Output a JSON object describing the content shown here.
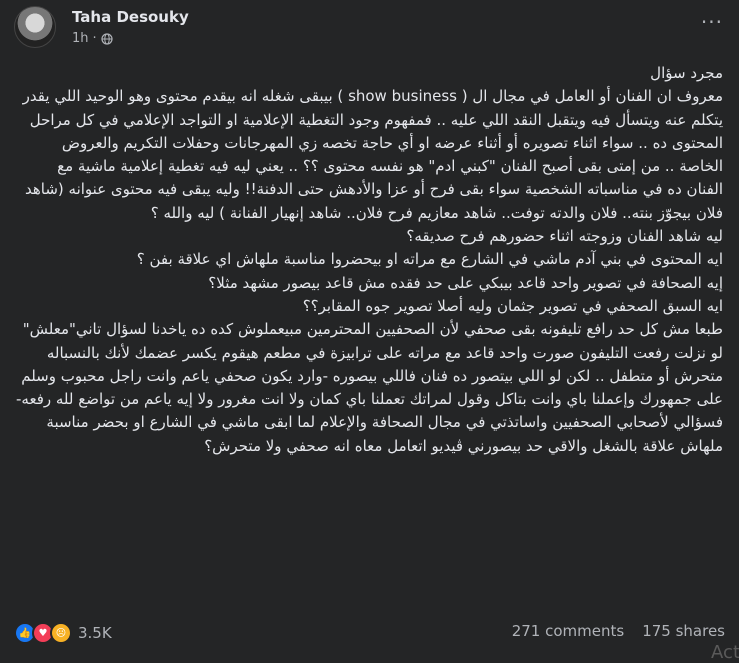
{
  "post": {
    "author": "Taha Desouky",
    "time": "1h",
    "separator": "·",
    "more": "···",
    "paragraphs": [
      "مجرد سؤال\nمعروف ان الفنان أو العامل في مجال ال ( show business ) بيبقى شغله انه بيقدم محتوى وهو الوحيد اللي يقدر يتكلم عنه ويتسأل فيه ويتقبل النقد اللي عليه .. فمفهوم وجود التغطية الإعلامية او التواجد الإعلامي في كل مراحل المحتوى ده .. سواء اثناء تصويره أو أثناء عرضه او أي حاجة تخصه زي المهرجانات وحفلات التكريم والعروض الخاصة .. من إمتى بقى أصبح الفنان \"كبني ادم\" هو نفسه محتوى ؟؟ .. يعني ليه فيه تغطية إعلامية ماشية مع الفنان ده في مناسباته الشخصية سواء بقى فرح أو عزا والأدهش حتى الدفنة!! وليه يبقى فيه محتوى عنوانه (شاهد فلان بيجوّز بنته.. فلان والدته توفت.. شاهد معازيم فرح فلان.. شاهد إنهيار الفنانة ) ليه والله ؟",
      "ليه شاهد الفنان وزوجته اثناء حضورهم فرح صديقه؟\nايه المحتوى في بني آدم ماشي في الشارع مع مراته او بيحضروا مناسبة ملهاش اي علاقة بفن ؟\nإيه الصحافة في تصوير واحد قاعد بيبكي على حد فقده مش قاعد بيصور مشهد مثلا؟\nايه السبق الصحفي في تصوير جثمان وليه أصلا تصوير جوه المقابر؟؟",
      "طبعا مش كل حد رافع تليفونه بقى صحفي لأن الصحفيين المحترمين مبيعملوش كده ده ياخدنا لسؤال تاني\"معلش\"",
      "لو نزلت رفعت التليفون صورت واحد قاعد مع مراته على ترابيزة في مطعم هيقوم يكسر عضمك لأنك بالنسباله متحرش أو متطفل .. لكن لو اللي بيتصور ده فنان فاللي بيصوره -وارد يكون صحفي ياعم وانت راجل محبوب وسلم على جمهورك وإعملنا باي وانت بتاكل وقول لمراتك تعملنا باي كمان ولا انت مغرور ولا إيه ياعم من تواضع لله رفعه-",
      " فسؤالي لأصحابي الصحفيين واساتذتي في مجال الصحافة والإعلام لما ابقى ماشي في الشارع او بحضر مناسبة ملهاش علاقة بالشغل والاقي حد بيصورني ڤيديو اتعامل معاه انه صحفي ولا متحرش؟"
    ]
  },
  "footer": {
    "reaction_count": "3.5K",
    "comments": "271 comments",
    "shares": "175 shares",
    "watermark": "Acti"
  },
  "icons": {
    "like": "like-icon",
    "love": "love-icon",
    "sad": "sad-icon",
    "globe": "globe-icon"
  },
  "colors": {
    "background": "#242526",
    "text": "#e4e6eb",
    "secondary": "#b0b3b8",
    "like": "#1877f2",
    "love": "#f33e58",
    "sad": "#f7b125"
  }
}
